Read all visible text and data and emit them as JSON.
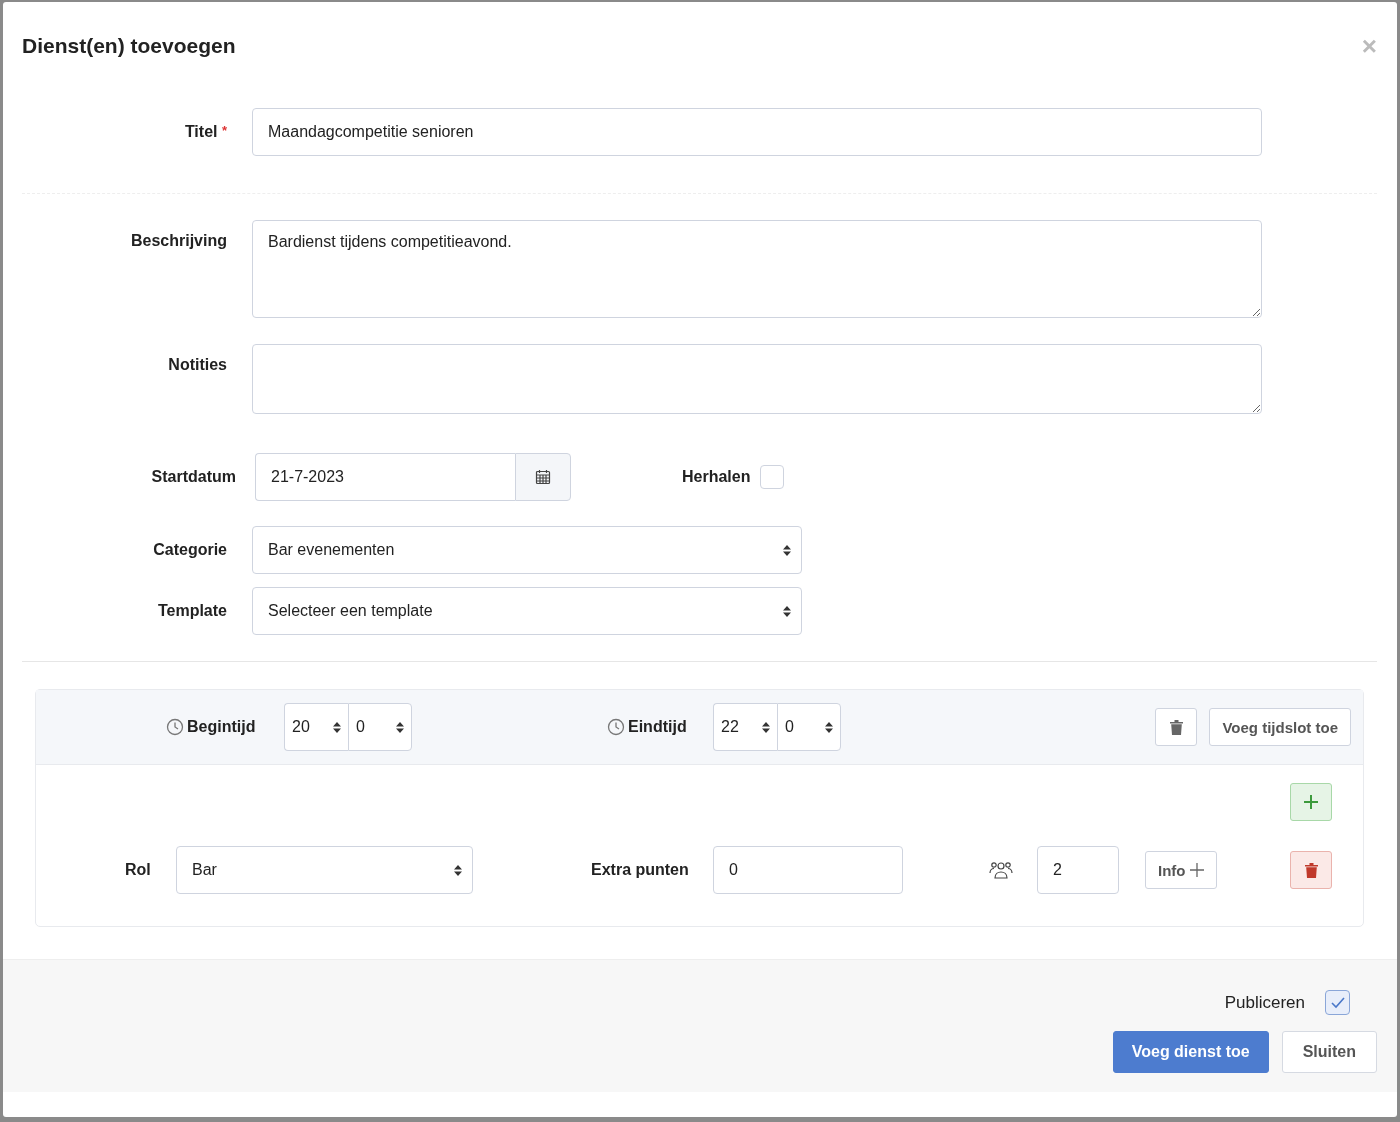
{
  "modal": {
    "title": "Dienst(en) toevoegen",
    "close": "×"
  },
  "title_field": {
    "label": "Titel",
    "required_mark": "*",
    "value": "Maandagcompetitie senioren"
  },
  "description_field": {
    "label": "Beschrijving",
    "value": "Bardienst tijdens competitieavond."
  },
  "notes_field": {
    "label": "Notities"
  },
  "start_date": {
    "label": "Startdatum",
    "value": "21-7-2023"
  },
  "repeat": {
    "label": "Herhalen",
    "checked": false
  },
  "category": {
    "label": "Categorie",
    "value": "Bar evenementen"
  },
  "template": {
    "label": "Template",
    "value": "Selecteer een template"
  },
  "timeslot": {
    "begin": {
      "label": "Begintijd",
      "hour": "20",
      "minute": "0"
    },
    "end": {
      "label": "Eindtijd",
      "hour": "22",
      "minute": "0"
    },
    "add_button": "Voeg tijdslot toe",
    "roles": [
      {
        "label": "Rol",
        "value": "Bar",
        "points_label": "Extra punten",
        "points": "0",
        "count": "2",
        "info_button": "Info"
      }
    ]
  },
  "footer": {
    "publish": {
      "label": "Publiceren",
      "checked": true
    },
    "buttons": [
      {
        "label": "Voeg dienst toe",
        "kind": "primary"
      },
      {
        "label": "Sluiten",
        "kind": "secondary"
      }
    ]
  }
}
